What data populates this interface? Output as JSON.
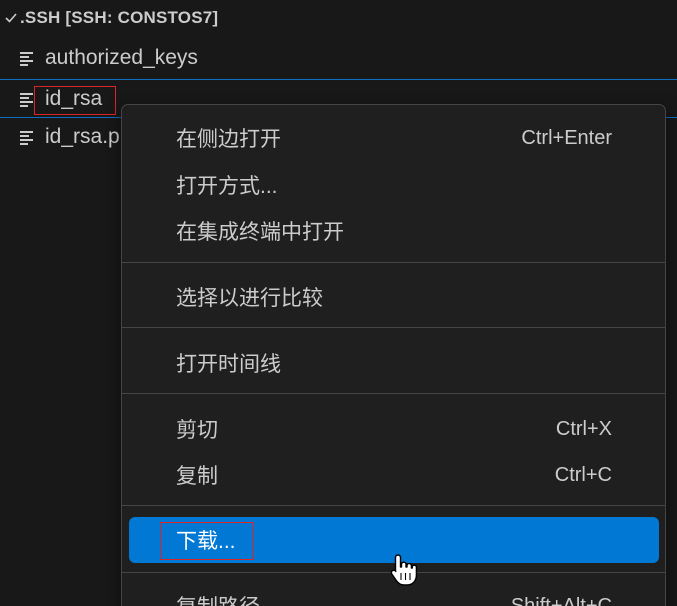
{
  "explorer": {
    "section_title": ".SSH [SSH: CONSTOS7]",
    "files": [
      {
        "name": "authorized_keys"
      },
      {
        "name": "id_rsa"
      },
      {
        "name": "id_rsa.p"
      }
    ]
  },
  "context_menu": {
    "items": [
      {
        "label": "在侧边打开",
        "shortcut": "Ctrl+Enter"
      },
      {
        "label": "打开方式...",
        "shortcut": ""
      },
      {
        "label": "在集成终端中打开",
        "shortcut": ""
      },
      {
        "label": "选择以进行比较",
        "shortcut": ""
      },
      {
        "label": "打开时间线",
        "shortcut": ""
      },
      {
        "label": "剪切",
        "shortcut": "Ctrl+X"
      },
      {
        "label": "复制",
        "shortcut": "Ctrl+C"
      },
      {
        "label": "下载...",
        "shortcut": ""
      },
      {
        "label": "复制路径",
        "shortcut": "Shift+Alt+C"
      }
    ]
  },
  "colors": {
    "background": "#181818",
    "menu_background": "#1f1f1f",
    "accent": "#0078d4",
    "highlight_box": "#d92626",
    "text": "#cccccc"
  },
  "icons": [
    "chevron-down-icon",
    "file-lines-icon",
    "hand-pointer-cursor-icon"
  ]
}
